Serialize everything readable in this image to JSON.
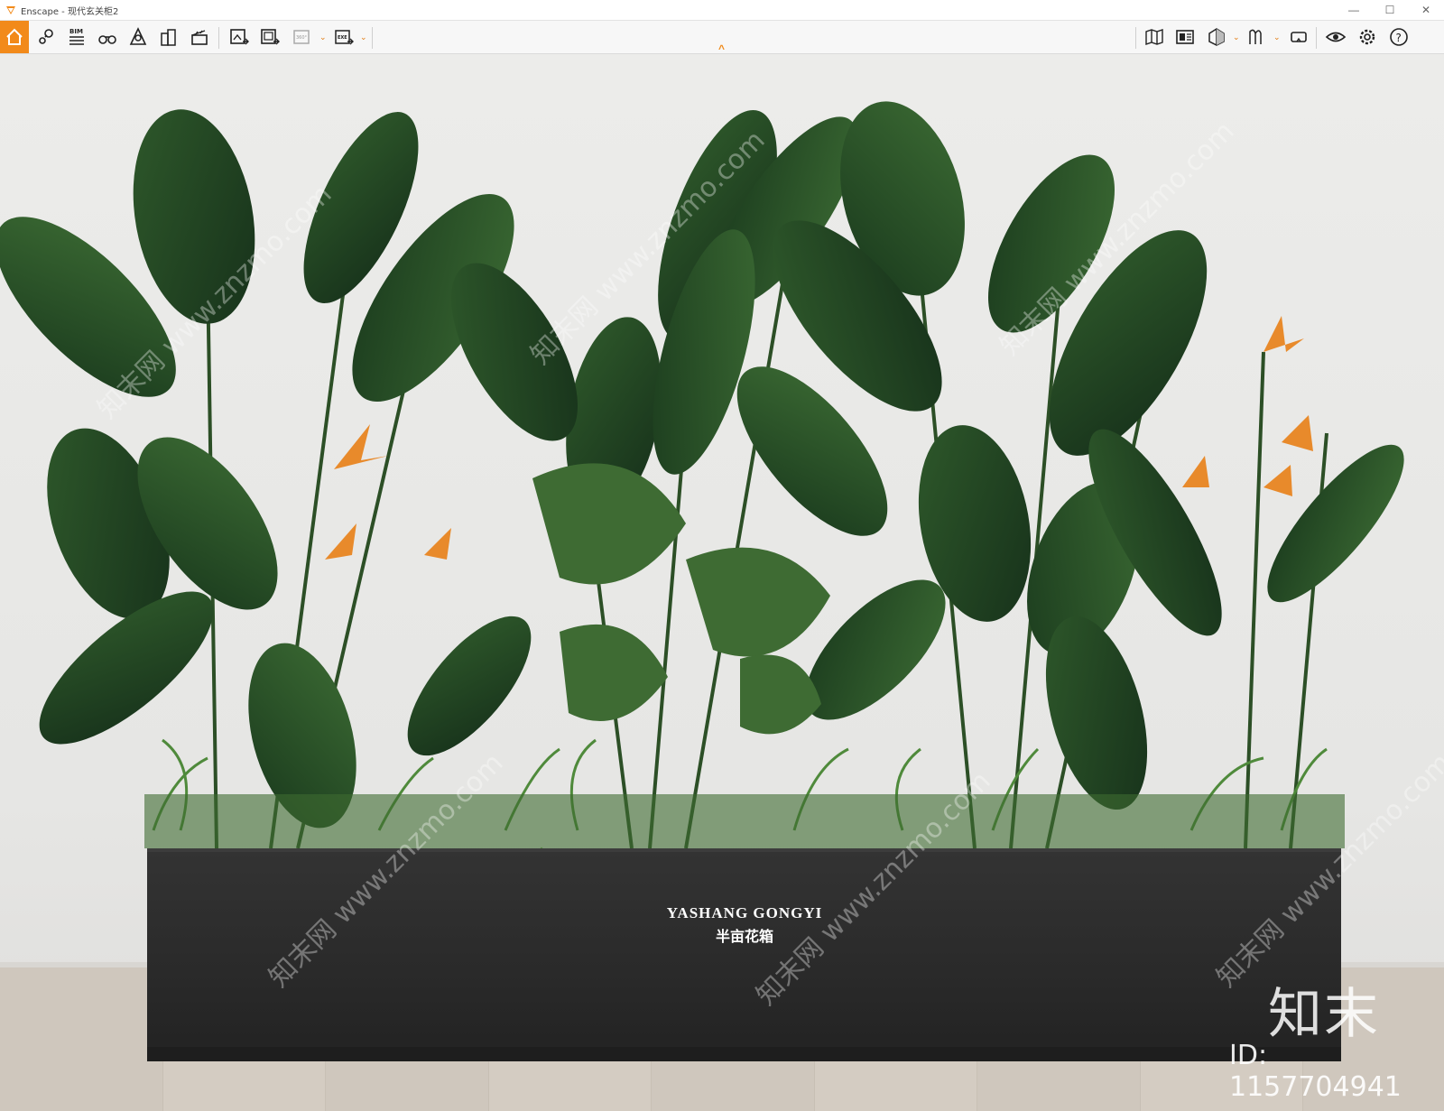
{
  "window": {
    "title": "Enscape - 现代玄关柜2",
    "controls": {
      "minimize": "—",
      "maximize": "☐",
      "close": "✕"
    }
  },
  "toolbar": {
    "left_tools": [
      {
        "name": "home-icon"
      },
      {
        "name": "settings-link-icon"
      },
      {
        "name": "bim-icon",
        "label": "BIM"
      },
      {
        "name": "binoculars-icon"
      },
      {
        "name": "walk-mode-icon"
      },
      {
        "name": "buildings-icon"
      },
      {
        "name": "clapper-icon"
      },
      {
        "name": "render-image-icon"
      },
      {
        "name": "batch-render-icon"
      },
      {
        "name": "panorama-360-icon",
        "label": "360°"
      },
      {
        "name": "export-exe-icon",
        "label": "EXE"
      }
    ],
    "right_tools": [
      {
        "name": "map-icon"
      },
      {
        "name": "asset-library-icon"
      },
      {
        "name": "view-cube-icon"
      },
      {
        "name": "material-icon"
      },
      {
        "name": "vr-headset-icon"
      },
      {
        "name": "eye-icon"
      },
      {
        "name": "gear-icon"
      },
      {
        "name": "help-icon",
        "label": "?"
      }
    ],
    "collapse_glyph": "^",
    "accent_color": "#f28a1a"
  },
  "scene": {
    "planter_brand": "YASHANG  GONGYI",
    "planter_subtitle": "半亩花箱",
    "watermark_logo": "知末",
    "watermark_id": "ID: 1157704941",
    "diagonal_watermark": "知末网 www.znzmo.com"
  }
}
